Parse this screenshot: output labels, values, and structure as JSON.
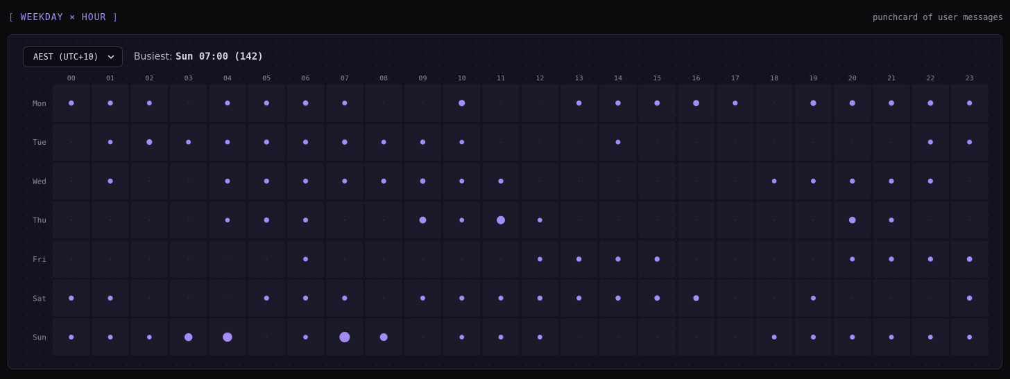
{
  "header": {
    "title": "WEEKDAY × HOUR",
    "subtitle": "punchcard of user messages"
  },
  "controls": {
    "timezone": "AEST (UTC+10)",
    "busiest_label": "Busiest:",
    "busiest_value": "Sun 07:00 (142)"
  },
  "colors": {
    "dot": "#a48cf5",
    "cell": "#1b1a2a",
    "accent": "#a492f0"
  },
  "chart_data": {
    "type": "scatter",
    "hours": [
      "00",
      "01",
      "02",
      "03",
      "04",
      "05",
      "06",
      "07",
      "08",
      "09",
      "10",
      "11",
      "12",
      "13",
      "14",
      "15",
      "16",
      "17",
      "18",
      "19",
      "20",
      "21",
      "22",
      "23"
    ],
    "days": [
      "Mon",
      "Tue",
      "Wed",
      "Thu",
      "Fri",
      "Sat",
      "Sun"
    ],
    "max": 142,
    "values": [
      [
        14,
        13,
        10,
        0,
        12,
        13,
        17,
        10,
        0,
        0,
        32,
        0,
        0,
        14,
        15,
        17,
        27,
        11,
        0,
        22,
        21,
        17,
        18,
        12
      ],
      [
        0,
        8,
        21,
        10,
        10,
        13,
        12,
        15,
        10,
        13,
        8,
        0,
        0,
        0,
        10,
        0,
        0,
        0,
        0,
        0,
        0,
        0,
        12,
        10
      ],
      [
        0,
        12,
        0,
        0,
        11,
        12,
        11,
        10,
        12,
        15,
        10,
        12,
        0,
        0,
        0,
        0,
        0,
        0,
        8,
        10,
        12,
        12,
        12,
        0
      ],
      [
        0,
        0,
        0,
        0,
        8,
        14,
        11,
        0,
        0,
        42,
        8,
        72,
        8,
        0,
        0,
        0,
        0,
        0,
        0,
        0,
        38,
        11,
        0,
        0
      ],
      [
        0,
        0,
        0,
        0,
        0,
        0,
        9,
        0,
        0,
        0,
        0,
        0,
        9,
        14,
        13,
        14,
        0,
        0,
        0,
        0,
        10,
        13,
        13,
        17
      ],
      [
        13,
        12,
        0,
        0,
        0,
        12,
        12,
        12,
        0,
        10,
        12,
        11,
        13,
        12,
        14,
        18,
        22,
        0,
        0,
        10,
        0,
        0,
        0,
        15
      ],
      [
        11,
        10,
        8,
        65,
        105,
        0,
        8,
        142,
        58,
        0,
        8,
        10,
        9,
        0,
        0,
        0,
        0,
        0,
        10,
        11,
        11,
        10,
        10,
        10
      ]
    ]
  }
}
